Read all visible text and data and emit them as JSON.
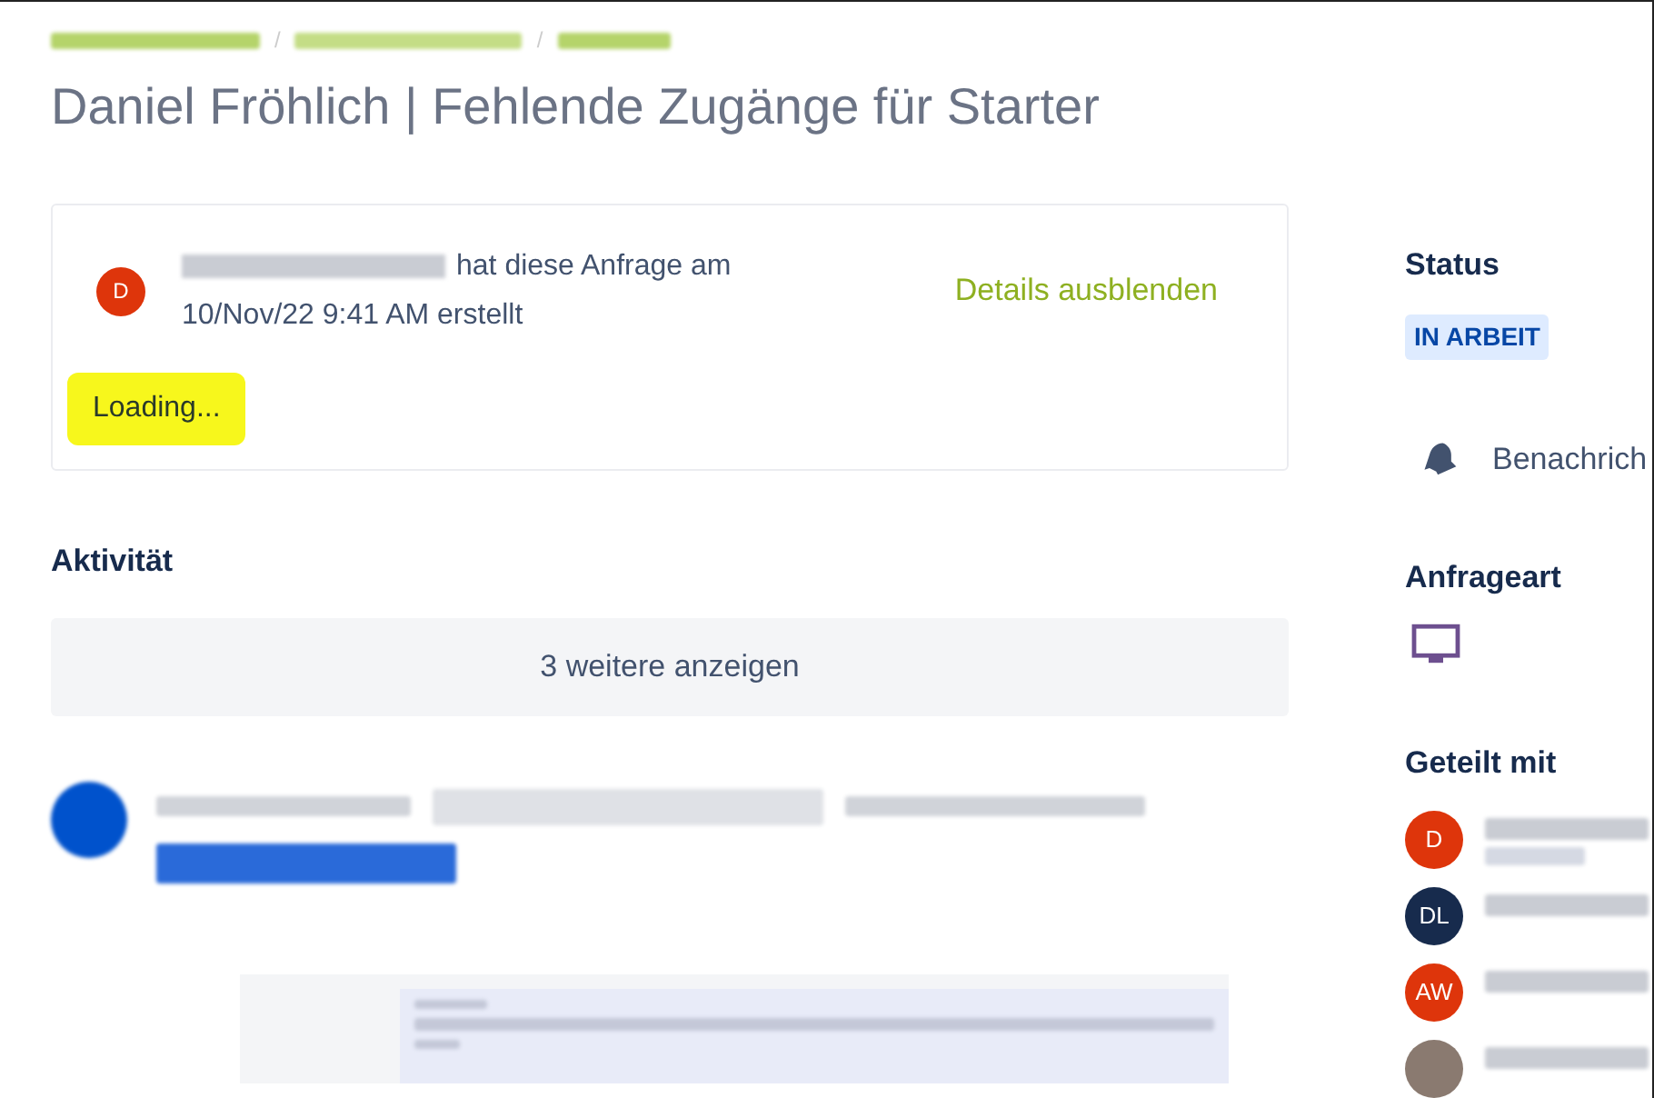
{
  "breadcrumb_separators": [
    "/",
    "/"
  ],
  "title": "Daniel Fröhlich | Fehlende Zugänge für Starter",
  "request_card": {
    "avatar_initial": "D",
    "created_text": "hat diese Anfrage am 10/Nov/22 9:41 AM erstellt",
    "toggle_link": "Details ausblenden",
    "loading": "Loading..."
  },
  "activity": {
    "heading": "Aktivität",
    "show_more": "3 weitere anzeigen"
  },
  "sidebar": {
    "status_label": "Status",
    "status_badge": "IN ARBEIT",
    "notifications": "Benachrich",
    "request_type_label": "Anfrageart",
    "shared_label": "Geteilt mit",
    "people": [
      {
        "kind": "initials",
        "initials": "D",
        "color": "#de350b",
        "subtitle": true
      },
      {
        "kind": "initials",
        "initials": "DL",
        "color": "#172b4d",
        "subtitle": false
      },
      {
        "kind": "initials",
        "initials": "AW",
        "color": "#de350b",
        "subtitle": false
      },
      {
        "kind": "photo",
        "subtitle": false
      }
    ]
  }
}
